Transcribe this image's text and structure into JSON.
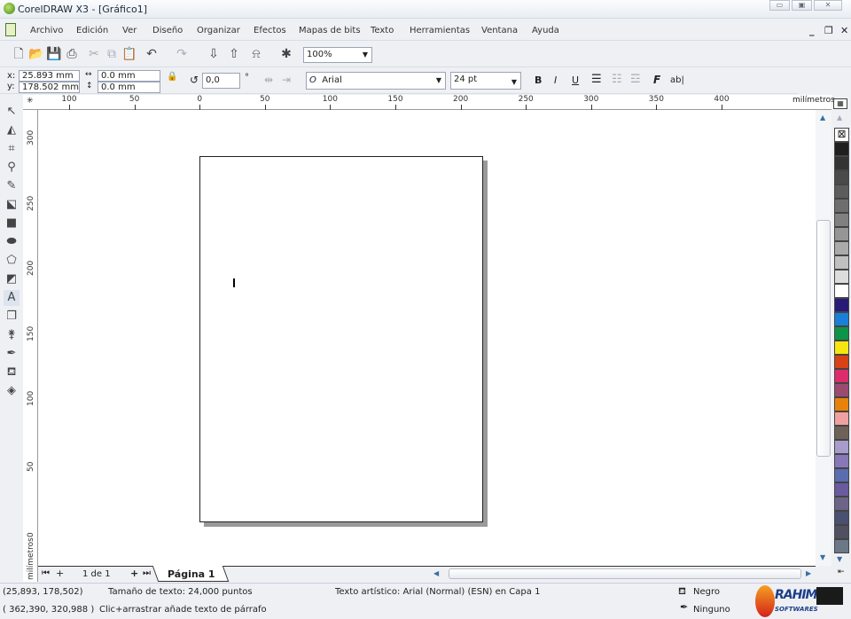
{
  "window": {
    "title": "CorelDRAW X3 - [Gráfico1]"
  },
  "menu": [
    "Archivo",
    "Edición",
    "Ver",
    "Diseño",
    "Organizar",
    "Efectos",
    "Mapas de bits",
    "Texto",
    "Herramientas",
    "Ventana",
    "Ayuda"
  ],
  "toolbar": {
    "zoom": "100%"
  },
  "propbar": {
    "x_label": "x:",
    "x": "25.893 mm",
    "y_label": "y:",
    "y": "178.502 mm",
    "w": "0.0 mm",
    "h": "0.0 mm",
    "angle": "0,0",
    "angle_unit": "°",
    "font": "Arial",
    "size": "24 pt",
    "ab": "ab|"
  },
  "ruler": {
    "h_labels": [
      "100",
      "50",
      "0",
      "50",
      "100",
      "150",
      "200",
      "250",
      "300",
      "350",
      "400"
    ],
    "units": "milímetros",
    "v_labels": [
      "300",
      "250",
      "200",
      "150",
      "100",
      "50",
      "0"
    ],
    "v_units": "milímetros"
  },
  "pages": {
    "counter": "1 de 1",
    "tab": "Página 1"
  },
  "status": {
    "coords": "(25,893, 178,502)",
    "text_size": "Tamaño de texto: 24,000 puntos",
    "coords2": "( 362,390, 320,988 )",
    "hint": "Clic+arrastrar añade texto de párrafo",
    "object": "Texto artístico: Arial (Normal) (ESN) en Capa 1",
    "fill": "Negro",
    "outline": "Ninguno"
  },
  "watermark": {
    "text": "RAHIM SOFTWARES"
  },
  "palette": [
    "#1f1f1f",
    "#333333",
    "#4a4a4a",
    "#5c5c5c",
    "#6e6e6e",
    "#808080",
    "#969696",
    "#aaaaaa",
    "#c0c0c0",
    "#dcdcdc",
    "#ffffff",
    "#2a1a78",
    "#1a7fd8",
    "#0e9448",
    "#f5e60f",
    "#d84214",
    "#dc2c6c",
    "#9c4a70",
    "#e8820c",
    "#f0a0a0",
    "#6e6258",
    "#a89ccc",
    "#8878b8",
    "#5c6cb0",
    "#6a5aa0",
    "#6e6488",
    "#4a5070",
    "#505060",
    "#6a7888"
  ]
}
